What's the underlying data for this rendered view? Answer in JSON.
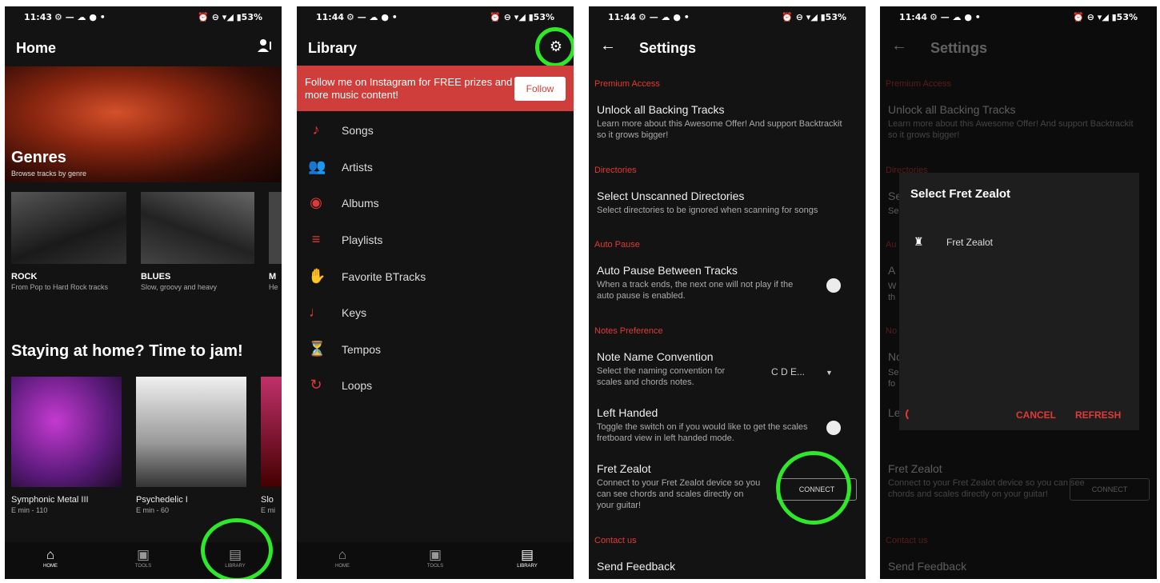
{
  "status": {
    "p1_time": "11:43",
    "p2_time": "11:44",
    "p3_time": "11:44",
    "p4_time": "11:44",
    "indicators": "⏰ ⊖ ▾◢ ▮53%",
    "left_icons": "⚙ — ☁ ● •"
  },
  "home": {
    "title": "Home",
    "icons": {
      "profile": "person-settings-icon"
    },
    "genres_title": "Genres",
    "genres_sub": "Browse tracks by genre",
    "genres": [
      {
        "title": "ROCK",
        "desc": "From Pop to Hard Rock tracks"
      },
      {
        "title": "BLUES",
        "desc": "Slow, groovy and heavy"
      },
      {
        "title": "M",
        "desc": "He"
      }
    ],
    "jam_title": "Staying at home? Time to jam!",
    "jam": [
      {
        "title": "Symphonic Metal III",
        "sub": "E min - 110"
      },
      {
        "title": "Psychedelic I",
        "sub": "E min - 60"
      },
      {
        "title": "Slo",
        "sub": "E mi"
      }
    ]
  },
  "nav": {
    "home": "HOME",
    "tools": "TOOLS",
    "library": "LIBRARY"
  },
  "library": {
    "title": "Library",
    "promo_text": "Follow me on Instagram for FREE prizes and more music content!",
    "follow": "Follow",
    "items": [
      {
        "label": "Songs",
        "icon": "♪"
      },
      {
        "label": "Artists",
        "icon": "👥"
      },
      {
        "label": "Albums",
        "icon": "◉"
      },
      {
        "label": "Playlists",
        "icon": "≡"
      },
      {
        "label": "Favorite BTracks",
        "icon": "✋"
      },
      {
        "label": "Keys",
        "icon": "♩"
      },
      {
        "label": "Tempos",
        "icon": "⏳"
      },
      {
        "label": "Loops",
        "icon": "↻"
      }
    ]
  },
  "settings": {
    "title": "Settings",
    "sec_premium": "Premium Access",
    "unlock_title": "Unlock all Backing Tracks",
    "unlock_desc": "Learn more about this Awesome Offer! And support Backtrackit so it grows bigger!",
    "sec_dirs": "Directories",
    "dirs_title": "Select Unscanned Directories",
    "dirs_desc": "Select directories to be ignored when scanning for songs",
    "sec_autopause": "Auto Pause",
    "ap_title": "Auto Pause Between Tracks",
    "ap_desc": "When a track ends, the next one will not play if the auto pause is enabled.",
    "sec_notes": "Notes Preference",
    "nn_title": "Note Name Convention",
    "nn_desc": "Select the naming convention for scales and chords notes.",
    "nn_value": "C D E...",
    "lh_title": "Left Handed",
    "lh_desc": "Toggle the switch on if you would like to get the scales fretboard view in left handed mode.",
    "fz_title": "Fret Zealot",
    "fz_desc": "Connect to your Fret Zealot device so you can see chords and scales directly on your guitar!",
    "connect": "CONNECT",
    "sec_contact": "Contact us",
    "feedback": "Send Feedback"
  },
  "dialog": {
    "title": "Select Fret Zealot",
    "item": "Fret Zealot",
    "cancel": "CANCEL",
    "refresh": "REFRESH",
    "peek": [
      "Se",
      "Se",
      "Au",
      "A",
      "W",
      "th",
      "No",
      "No",
      "Se",
      "fo",
      "Le"
    ]
  },
  "colors": {
    "accent": "#e03a36",
    "highlight": "#2ee829",
    "bg": "#131313"
  }
}
